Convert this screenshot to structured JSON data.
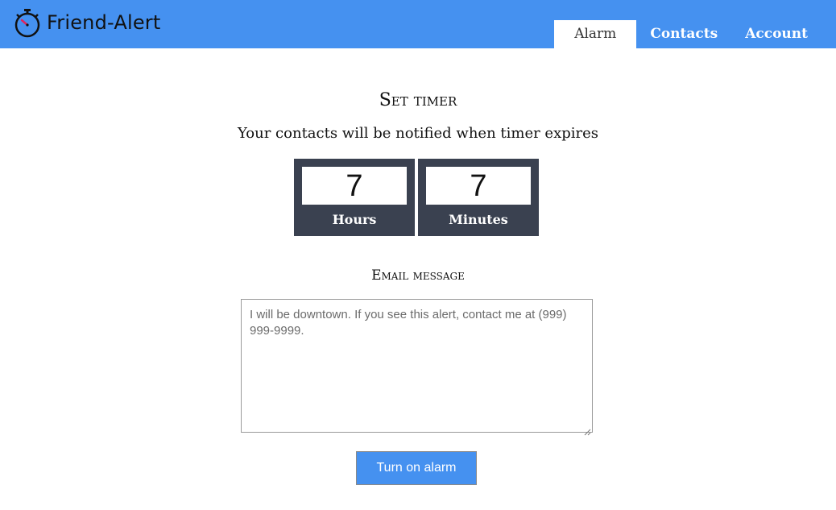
{
  "app": {
    "name": "Friend-Alert",
    "logo_icon": "stopwatch-icon"
  },
  "nav": {
    "tabs": [
      {
        "label": "Alarm",
        "active": true
      },
      {
        "label": "Contacts",
        "active": false
      },
      {
        "label": "Account",
        "active": false
      }
    ]
  },
  "timer_section": {
    "title": "Set timer",
    "subtitle": "Your contacts will be notified when timer expires",
    "hours": {
      "value": "7",
      "label": "Hours"
    },
    "minutes": {
      "value": "7",
      "label": "Minutes"
    }
  },
  "email_section": {
    "heading": "Email message",
    "message": "I will be downtown. If you see this alert, contact me at (999) 999-9999."
  },
  "actions": {
    "turn_on_label": "Turn on alarm"
  },
  "colors": {
    "header_bg": "#4591f0",
    "timer_bg": "#3a4150",
    "button_bg": "#4591f0",
    "stopwatch_hand": "#e0245e"
  }
}
